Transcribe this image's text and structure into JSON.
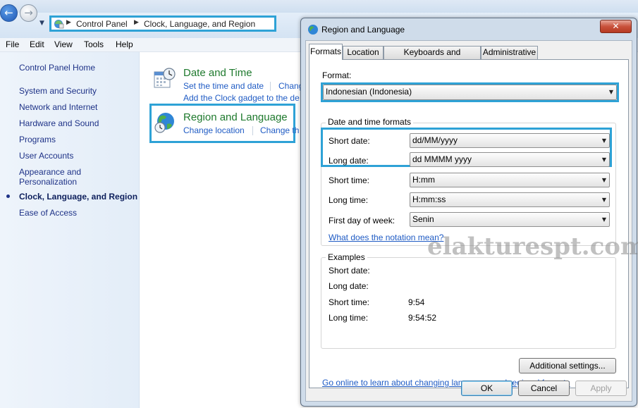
{
  "colors": {
    "accent_highlight": "#2ea2d6",
    "link": "#1f5bc4",
    "category_title": "#1f7a2e",
    "sidebar_link": "#1e3287"
  },
  "address_bar": {
    "crumbs": [
      "Control Panel",
      "Clock, Language, and Region"
    ]
  },
  "menu": [
    "File",
    "Edit",
    "View",
    "Tools",
    "Help"
  ],
  "sidebar": {
    "items": [
      {
        "label": "Control Panel Home"
      },
      {
        "label": "System and Security"
      },
      {
        "label": "Network and Internet"
      },
      {
        "label": "Hardware and Sound"
      },
      {
        "label": "Programs"
      },
      {
        "label": "User Accounts"
      },
      {
        "label": "Appearance and Personalization"
      },
      {
        "label": "Clock, Language, and Region",
        "current": true
      },
      {
        "label": "Ease of Access"
      }
    ]
  },
  "categories": {
    "date_time": {
      "title": "Date and Time",
      "link1": "Set the time and date",
      "link2": "Chang",
      "link3": "Add the Clock gadget to the de",
      "icon": "calendar-clock-icon"
    },
    "region": {
      "title": "Region and Language",
      "link1": "Change location",
      "link2": "Change th",
      "icon": "globe-clock-icon"
    }
  },
  "watermark": "elakturespt.com",
  "dialog": {
    "title": "Region and Language",
    "close_glyph": "✕",
    "tabs": [
      "Formats",
      "Location",
      "Keyboards and Languages",
      "Administrative"
    ],
    "active_tab": "Formats",
    "format_label": "Format:",
    "format_value": "Indonesian (Indonesia)",
    "dt_group_title": "Date and time formats",
    "fields": {
      "short_date": {
        "label": "Short date:",
        "value": "dd/MM/yyyy"
      },
      "long_date": {
        "label": "Long date:",
        "value": "dd MMMM yyyy"
      },
      "short_time": {
        "label": "Short time:",
        "value": "H:mm"
      },
      "long_time": {
        "label": "Long time:",
        "value": "H:mm:ss"
      },
      "first_day": {
        "label": "First day of week:",
        "value": "Senin"
      }
    },
    "notation_link": "What does the notation mean?",
    "examples": {
      "title": "Examples",
      "short_date": {
        "label": "Short date:",
        "value": ""
      },
      "long_date": {
        "label": "Long date:",
        "value": ""
      },
      "short_time": {
        "label": "Short time:",
        "value": "9:54"
      },
      "long_time": {
        "label": "Long time:",
        "value": "9:54:52"
      }
    },
    "additional_settings": "Additional settings...",
    "online_link": "Go online to learn about changing languages and regional formats",
    "buttons": {
      "ok": "OK",
      "cancel": "Cancel",
      "apply": "Apply"
    }
  }
}
